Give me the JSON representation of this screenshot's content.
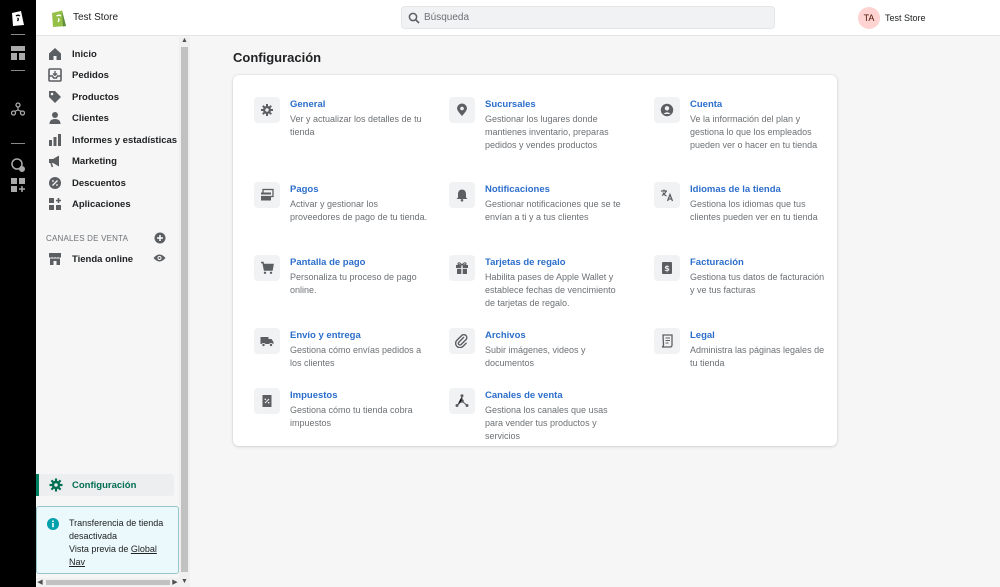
{
  "store": {
    "name": "Test Store"
  },
  "search": {
    "placeholder": "Búsqueda"
  },
  "user": {
    "initials": "TA",
    "name": "Test Store"
  },
  "sidebar": {
    "items": [
      {
        "label": "Inicio",
        "icon": "home-icon"
      },
      {
        "label": "Pedidos",
        "icon": "orders-icon"
      },
      {
        "label": "Productos",
        "icon": "tag-icon"
      },
      {
        "label": "Clientes",
        "icon": "customer-icon"
      },
      {
        "label": "Informes y estadísticas",
        "icon": "bar-chart-icon"
      },
      {
        "label": "Marketing",
        "icon": "megaphone-icon"
      },
      {
        "label": "Descuentos",
        "icon": "discount-icon"
      },
      {
        "label": "Aplicaciones",
        "icon": "apps-icon"
      }
    ],
    "sales_channels_title": "CANALES DE VENTA",
    "online_store": "Tienda online",
    "settings": "Configuración",
    "notice": {
      "text": "Transferencia de tienda desactivada",
      "preview_prefix": "Vista previa de ",
      "preview_link": "Global Nav"
    }
  },
  "main": {
    "title": "Configuración",
    "settings": [
      {
        "title": "General",
        "desc": "Ver y actualizar los detalles de tu tienda",
        "icon": "gear-icon"
      },
      {
        "title": "Sucursales",
        "desc": "Gestionar los lugares donde mantienes inventario, preparas pedidos y vendes productos",
        "icon": "location-icon"
      },
      {
        "title": "Cuenta",
        "desc": "Ve la información del plan y gestiona lo que los empleados pueden ver o hacer en tu tienda",
        "icon": "account-icon"
      },
      {
        "title": "Pagos",
        "desc": "Activar y gestionar los proveedores de pago de tu tienda.",
        "icon": "payment-icon"
      },
      {
        "title": "Notificaciones",
        "desc": "Gestionar notificaciones que se te envían a ti y a tus clientes",
        "icon": "bell-icon"
      },
      {
        "title": "Idiomas de la tienda",
        "desc": "Gestiona los idiomas que tus clientes pueden ver en tu tienda",
        "icon": "translate-icon"
      },
      {
        "title": "Pantalla de pago",
        "desc": "Personaliza tu proceso de pago online.",
        "icon": "cart-icon"
      },
      {
        "title": "Tarjetas de regalo",
        "desc": "Habilita pases de Apple Wallet y establece fechas de vencimiento de tarjetas de regalo.",
        "icon": "gift-icon"
      },
      {
        "title": "Facturación",
        "desc": "Gestiona tus datos de facturación y ve tus facturas",
        "icon": "billing-icon"
      },
      {
        "title": "Envío y entrega",
        "desc": "Gestiona cómo envías pedidos a los clientes",
        "icon": "truck-icon"
      },
      {
        "title": "Archivos",
        "desc": "Subir imágenes, videos y documentos",
        "icon": "attachment-icon"
      },
      {
        "title": "Legal",
        "desc": "Administra las páginas legales de tu tienda",
        "icon": "legal-icon"
      },
      {
        "title": "Impuestos",
        "desc": "Gestiona cómo tu tienda cobra impuestos",
        "icon": "taxes-icon"
      },
      {
        "title": "Canales de venta",
        "desc": "Gestiona los canales que usas para vender tus productos y servicios",
        "icon": "channels-icon"
      }
    ]
  },
  "colors": {
    "accent": "#008060",
    "link": "#2c6ecb",
    "rail": "#000000"
  }
}
